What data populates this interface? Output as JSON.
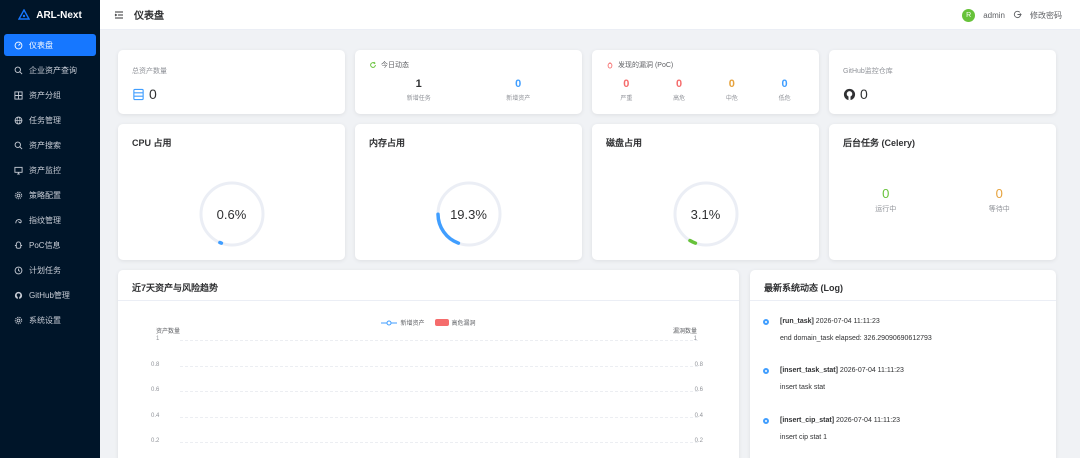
{
  "app": {
    "name": "ARL-Next"
  },
  "sidebar": {
    "items": [
      {
        "label": "仪表盘",
        "icon": "dashboard-icon",
        "active": true
      },
      {
        "label": "企业资产查询",
        "icon": "search-icon",
        "active": false
      },
      {
        "label": "资产分组",
        "icon": "grid-icon",
        "active": false
      },
      {
        "label": "任务管理",
        "icon": "globe-icon",
        "active": false
      },
      {
        "label": "资产搜索",
        "icon": "search-icon",
        "active": false
      },
      {
        "label": "资产监控",
        "icon": "monitor-icon",
        "active": false
      },
      {
        "label": "策略配置",
        "icon": "settings-icon",
        "active": false
      },
      {
        "label": "指纹管理",
        "icon": "fingerprint-icon",
        "active": false
      },
      {
        "label": "PoC信息",
        "icon": "poc-icon",
        "active": false
      },
      {
        "label": "计划任务",
        "icon": "clock-icon",
        "active": false
      },
      {
        "label": "GitHub管理",
        "icon": "github-icon",
        "active": false
      },
      {
        "label": "系统设置",
        "icon": "settings-icon",
        "active": false
      }
    ]
  },
  "header": {
    "title": "仪表盘",
    "user": "admin",
    "avatar_letter": "R",
    "change_password": "修改密码"
  },
  "cards": {
    "total_assets": {
      "title": "总资产数量",
      "value": "0"
    },
    "today": {
      "title": "今日动态",
      "items": [
        {
          "value": "1",
          "label": "新增任务"
        },
        {
          "value": "0",
          "label": "新增资产"
        }
      ]
    },
    "vulns": {
      "title": "发现的漏洞 (PoC)",
      "items": [
        {
          "value": "0",
          "label": "严重"
        },
        {
          "value": "0",
          "label": "高危"
        },
        {
          "value": "0",
          "label": "中危"
        },
        {
          "value": "0",
          "label": "低危"
        }
      ]
    },
    "github": {
      "title": "GitHub监控仓库",
      "value": "0"
    },
    "cpu": {
      "title": "CPU 占用",
      "value_text": "0.6%",
      "percent": 0.6
    },
    "memory": {
      "title": "内存占用",
      "value_text": "19.3%",
      "percent": 19.3
    },
    "disk": {
      "title": "磁盘占用",
      "value_text": "3.1%",
      "percent": 3.1
    },
    "celery": {
      "title": "后台任务 (Celery)",
      "items": [
        {
          "value": "0",
          "label": "运行中"
        },
        {
          "value": "0",
          "label": "等待中"
        }
      ]
    }
  },
  "chart": {
    "title": "近7天资产与风险趋势",
    "legend": [
      {
        "label": "新增资产",
        "color": "#409eff"
      },
      {
        "label": "高危漏洞",
        "color": "#f56c6c"
      }
    ],
    "left_axis_name": "资产数量",
    "right_axis_name": "漏洞数量",
    "y_ticks": [
      "1",
      "0.8",
      "0.6",
      "0.4",
      "0.2"
    ]
  },
  "chart_data": {
    "type": "line",
    "title": "近7天资产与风险趋势",
    "ylabel": "资产数量",
    "y2label": "漏洞数量",
    "ylim": [
      0,
      1
    ],
    "y2lim": [
      0,
      1
    ],
    "series": [
      {
        "name": "新增资产",
        "values": []
      },
      {
        "name": "高危漏洞",
        "values": []
      }
    ],
    "legend": "top-center",
    "grid": true
  },
  "log": {
    "title": "最新系统动态 (Log)",
    "entries": [
      {
        "tag": "[run_task]",
        "time": "2026-07-04 11:11:23",
        "message": "end domain_task elapsed: 326.29090690612793"
      },
      {
        "tag": "[insert_task_stat]",
        "time": "2026-07-04 11:11:23",
        "message": "insert task stat"
      },
      {
        "tag": "[insert_cip_stat]",
        "time": "2026-07-04 11:11:23",
        "message": "insert cip stat 1"
      }
    ]
  },
  "colors": {
    "primary": "#1677ff",
    "blue": "#409eff",
    "red": "#f56c6c",
    "orange": "#e6a23c",
    "green": "#67c23a",
    "sidebar_bg": "#001529"
  }
}
